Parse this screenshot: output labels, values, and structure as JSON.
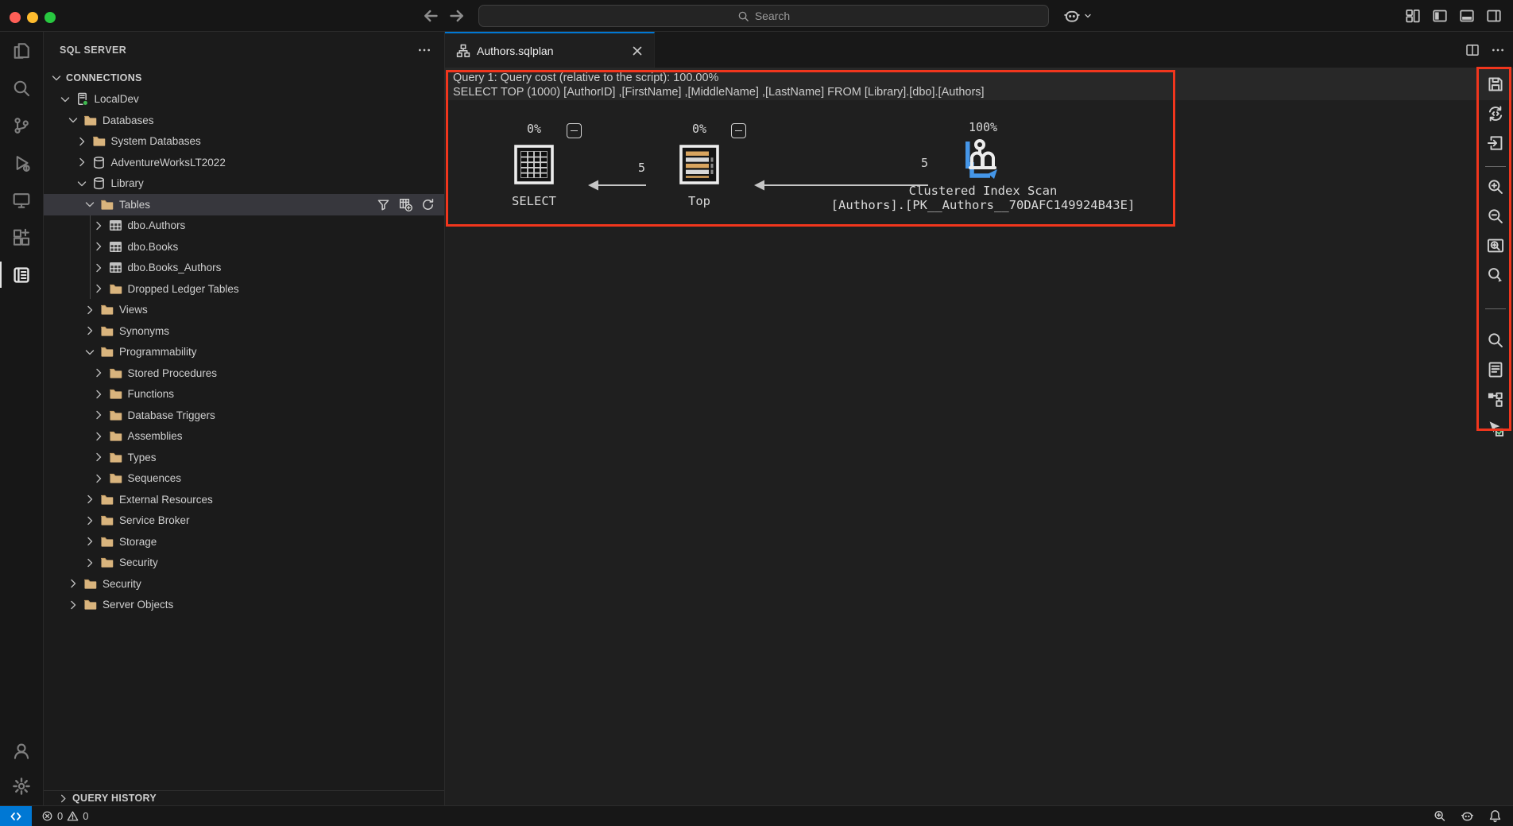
{
  "colors": {
    "annotation_red": "#f1361d",
    "accent_blue": "#0078d4",
    "folder_tan": "#d9b47d",
    "connected_green": "#3fb950",
    "top_operator_tan": "#d9a55f",
    "index_scan_blue": "#4596e8"
  },
  "title_bar": {
    "search_placeholder": "Search",
    "right_icons": [
      "customize-layout",
      "panel-left",
      "panel-bottom",
      "panel-right"
    ],
    "copilot_icon": "copilot"
  },
  "activity_bar": {
    "items": [
      {
        "name": "explorer",
        "active": false
      },
      {
        "name": "search",
        "active": false
      },
      {
        "name": "source-control",
        "active": false
      },
      {
        "name": "run-and-debug",
        "active": false
      },
      {
        "name": "remote-explorer",
        "active": false
      },
      {
        "name": "extensions",
        "active": false
      },
      {
        "name": "sql-server",
        "active": true
      }
    ],
    "footer": [
      {
        "name": "accounts"
      },
      {
        "name": "settings"
      }
    ]
  },
  "sidebar": {
    "title": "SQL SERVER",
    "bottom_section_label": "QUERY HISTORY",
    "tree": [
      {
        "label": "CONNECTIONS",
        "level": 0,
        "chevron": "down",
        "icon": null,
        "section": true
      },
      {
        "label": "LocalDev",
        "level": 1,
        "chevron": "down",
        "icon": "server"
      },
      {
        "label": "Databases",
        "level": 2,
        "chevron": "down",
        "icon": "folder"
      },
      {
        "label": "System Databases",
        "level": 3,
        "chevron": "right",
        "icon": "folder"
      },
      {
        "label": "AdventureWorksLT2022",
        "level": 3,
        "chevron": "right",
        "icon": "database"
      },
      {
        "label": "Library",
        "level": 3,
        "chevron": "down",
        "icon": "database"
      },
      {
        "label": "Tables",
        "level": 4,
        "chevron": "down",
        "icon": "folder",
        "selected": true,
        "actions": [
          "filter",
          "new-table",
          "refresh"
        ]
      },
      {
        "label": "dbo.Authors",
        "level": 5,
        "chevron": "right",
        "icon": "table"
      },
      {
        "label": "dbo.Books",
        "level": 5,
        "chevron": "right",
        "icon": "table"
      },
      {
        "label": "dbo.Books_Authors",
        "level": 5,
        "chevron": "right",
        "icon": "table"
      },
      {
        "label": "Dropped Ledger Tables",
        "level": 5,
        "chevron": "right",
        "icon": "folder"
      },
      {
        "label": "Views",
        "level": 4,
        "chevron": "right",
        "icon": "folder"
      },
      {
        "label": "Synonyms",
        "level": 4,
        "chevron": "right",
        "icon": "folder"
      },
      {
        "label": "Programmability",
        "level": 4,
        "chevron": "down",
        "icon": "folder"
      },
      {
        "label": "Stored Procedures",
        "level": 5,
        "chevron": "right",
        "icon": "folder"
      },
      {
        "label": "Functions",
        "level": 5,
        "chevron": "right",
        "icon": "folder"
      },
      {
        "label": "Database Triggers",
        "level": 5,
        "chevron": "right",
        "icon": "folder"
      },
      {
        "label": "Assemblies",
        "level": 5,
        "chevron": "right",
        "icon": "folder"
      },
      {
        "label": "Types",
        "level": 5,
        "chevron": "right",
        "icon": "folder"
      },
      {
        "label": "Sequences",
        "level": 5,
        "chevron": "right",
        "icon": "folder"
      },
      {
        "label": "External Resources",
        "level": 4,
        "chevron": "right",
        "icon": "folder"
      },
      {
        "label": "Service Broker",
        "level": 4,
        "chevron": "right",
        "icon": "folder"
      },
      {
        "label": "Storage",
        "level": 4,
        "chevron": "right",
        "icon": "folder"
      },
      {
        "label": "Security",
        "level": 4,
        "chevron": "right",
        "icon": "folder"
      },
      {
        "label": "Security",
        "level": 2,
        "chevron": "right",
        "icon": "folder"
      },
      {
        "label": "Server Objects",
        "level": 2,
        "chevron": "right",
        "icon": "folder"
      }
    ]
  },
  "editor": {
    "tab_label": "Authors.sqlplan",
    "plan": {
      "header_line1": "Query 1: Query cost (relative to the script): 100.00%",
      "header_line2": "SELECT TOP (1000) [AuthorID] ,[FirstName] ,[MiddleName] ,[LastName] FROM [Library].[dbo].[Authors]",
      "nodes": [
        {
          "label": "SELECT",
          "cost": "0%",
          "icon": "result-set"
        },
        {
          "label": "Top",
          "cost": "0%",
          "icon": "top-rows"
        },
        {
          "label": "Clustered Index Scan",
          "sublabel": "[Authors].[PK__Authors__70DAFC149924B43E]",
          "cost": "100%",
          "icon": "clustered-index-scan"
        }
      ],
      "edges": [
        {
          "rows": "5"
        },
        {
          "rows": "5"
        }
      ]
    },
    "toolbar_groups": [
      [
        "save",
        "open-query",
        "open-plan-file"
      ],
      [
        "zoom-in",
        "zoom-out",
        "zoom-to-fit",
        "custom-zoom"
      ],
      [
        "find-node",
        "properties",
        "highlight-expensive-operation",
        "actual-plan"
      ]
    ]
  },
  "status_bar": {
    "error_count": "0",
    "warning_count": "0",
    "right_icons": [
      "screen-zoom",
      "copilot",
      "notifications-bell"
    ]
  }
}
